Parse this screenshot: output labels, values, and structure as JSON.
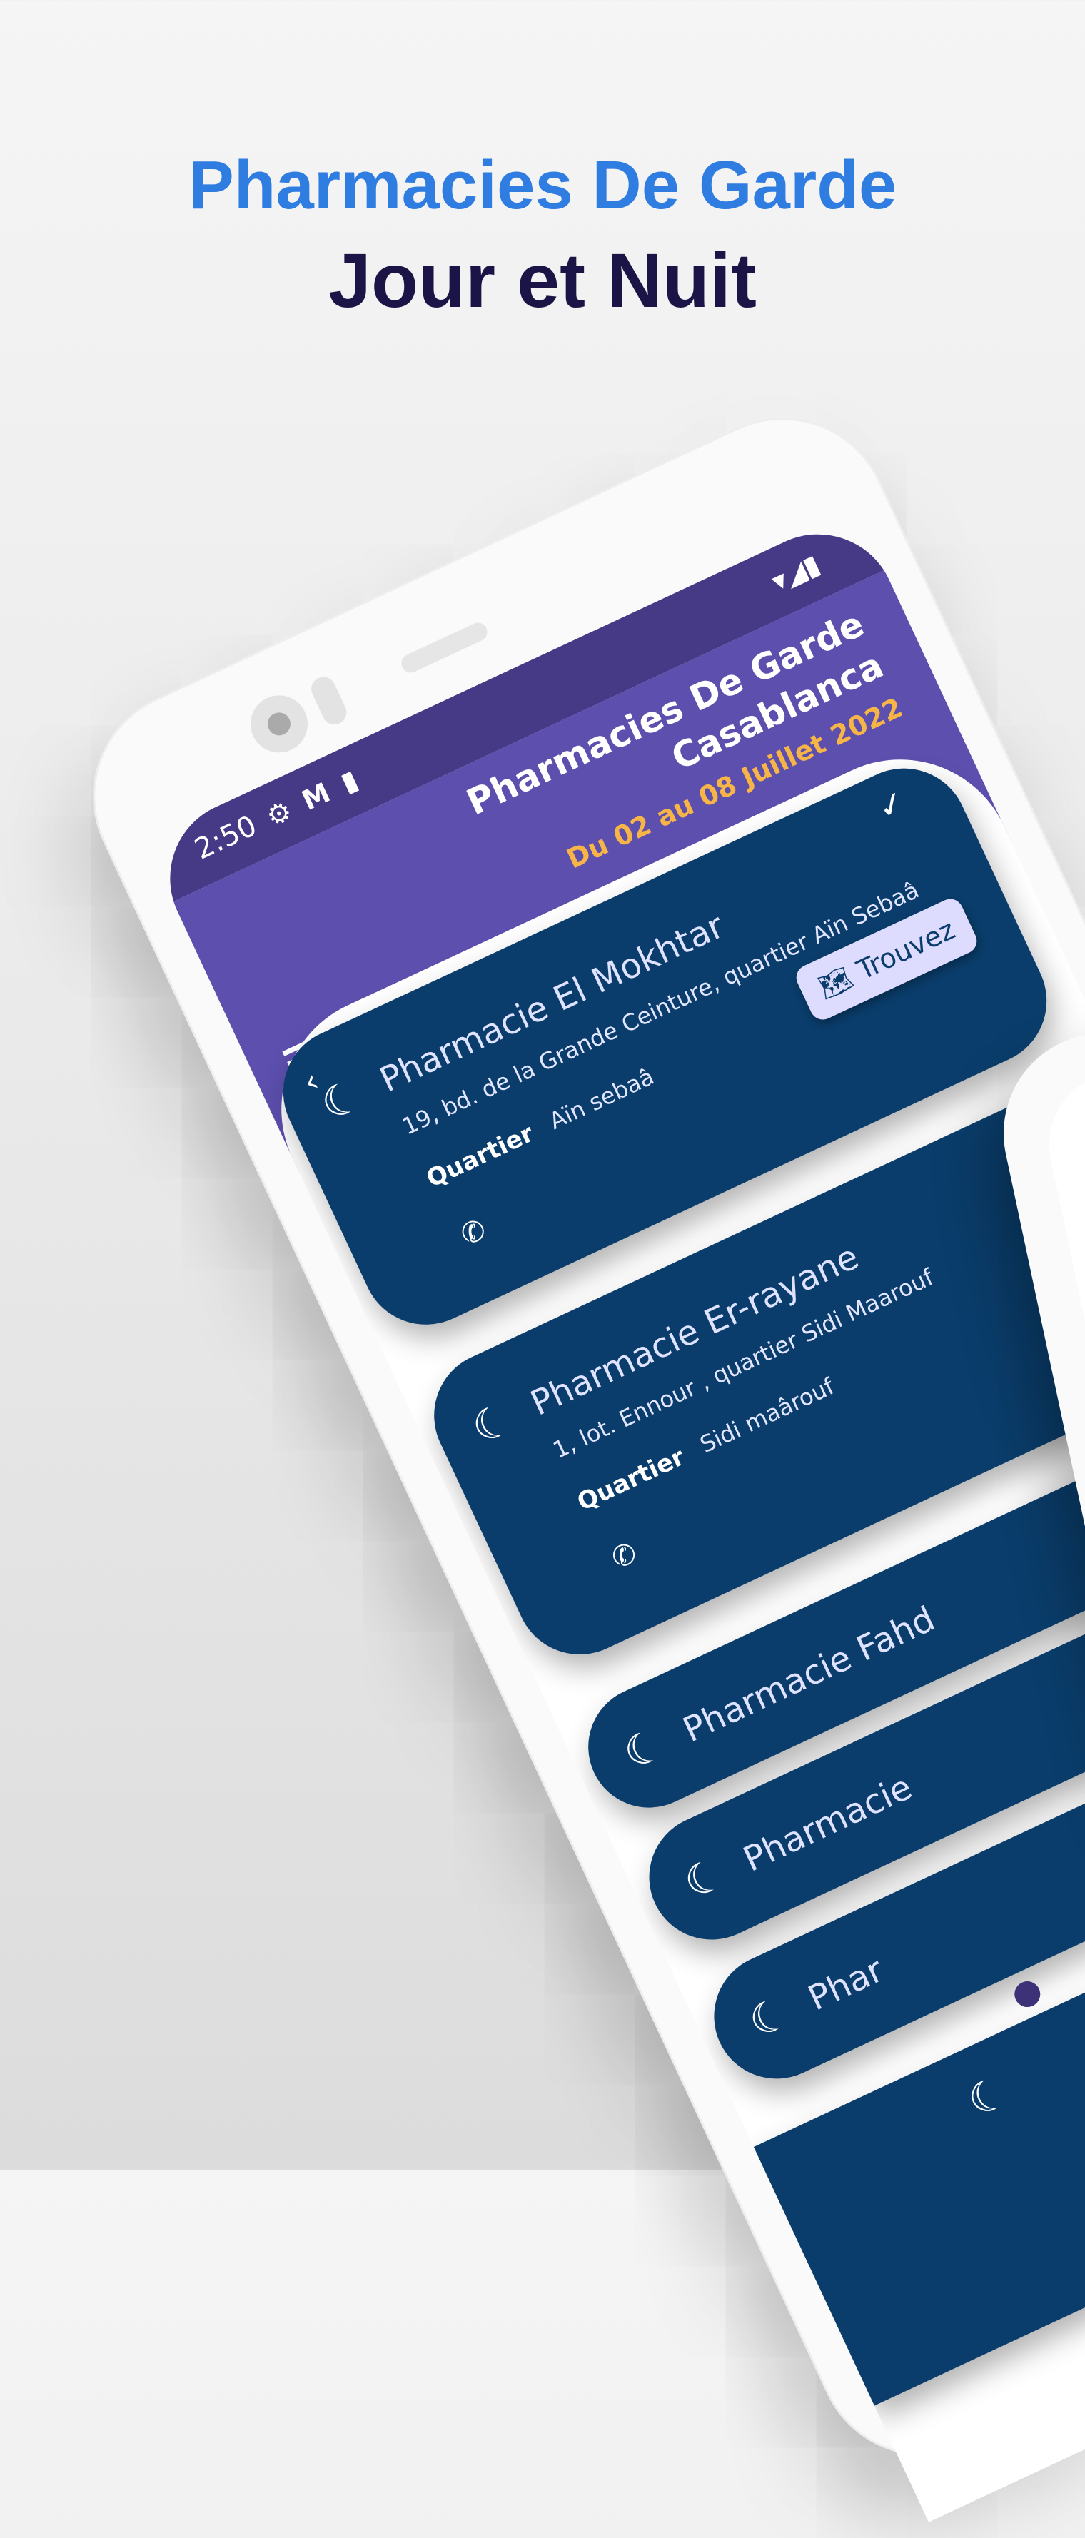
{
  "promo": {
    "title": "Pharmacies De Garde",
    "subtitle": "Jour et Nuit"
  },
  "status_bar": {
    "time": "2:50"
  },
  "header": {
    "title_line1": "Pharmacies De Garde",
    "title_line2": "Casablanca",
    "date_range": "Du 02 au 08 Juillet 2022"
  },
  "pharmacies": [
    {
      "name": "Pharmacie El Mokhtar",
      "address": "19, bd. de la Grande Ceinture, quartier Aïn Sebaâ",
      "quartier_label": "Quartier",
      "quartier": "Aïn sebaâ",
      "button": "Trouvez"
    },
    {
      "name": "Pharmacie Er-rayane",
      "address": "1, lot. Ennour , quartier Sidi Maarouf",
      "quartier_label": "Quartier",
      "quartier": "Sidi maârouf"
    },
    {
      "name": "Pharmacie Fahd"
    },
    {
      "name": "Pharmacie"
    },
    {
      "name": "Phar"
    }
  ],
  "colors": {
    "accent": "#2f7de1",
    "header": "#5c4fae",
    "card": "#0a3d6b",
    "date": "#f7b548"
  }
}
